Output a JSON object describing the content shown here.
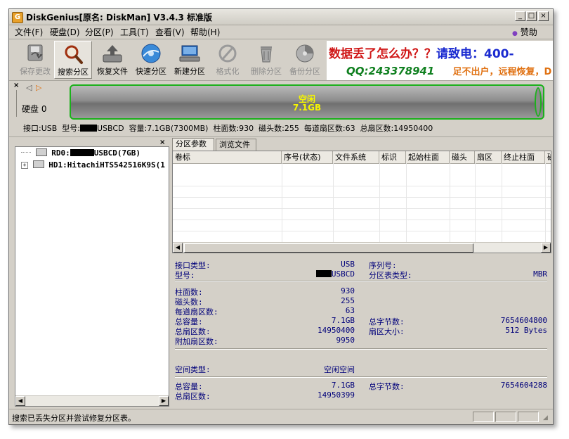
{
  "window": {
    "title": "DiskGenius[原名: DiskMan] V3.4.3 标准版",
    "controls": [
      "_",
      "□",
      "×"
    ]
  },
  "menu": {
    "items": [
      "文件(F)",
      "硬盘(D)",
      "分区(P)",
      "工具(T)",
      "查看(V)",
      "帮助(H)"
    ],
    "donate": "赞助"
  },
  "toolbar": {
    "buttons": [
      {
        "label": "保存更改",
        "icon": "save-changes-icon",
        "enabled": false
      },
      {
        "label": "搜索分区",
        "icon": "search-partition-icon",
        "enabled": true,
        "active": true
      },
      {
        "label": "恢复文件",
        "icon": "recover-files-icon",
        "enabled": true
      },
      {
        "label": "快速分区",
        "icon": "quick-partition-icon",
        "enabled": true
      },
      {
        "label": "新建分区",
        "icon": "new-partition-icon",
        "enabled": true
      },
      {
        "label": "格式化",
        "icon": "format-icon",
        "enabled": false
      },
      {
        "label": "删除分区",
        "icon": "delete-partition-icon",
        "enabled": false
      },
      {
        "label": "备份分区",
        "icon": "backup-partition-icon",
        "enabled": false
      }
    ]
  },
  "ad": {
    "line1_a": "数据丢了怎么办？？",
    "line1_b": "请致电：400-",
    "line2_a": "QQ:243378941",
    "line2_b": "足不出户，远程恢复，D"
  },
  "disk_panel": {
    "label": "硬盘 0",
    "bar_label": "空闲",
    "bar_size": "7.1GB",
    "info": {
      "interface": "接口:USB",
      "model_prefix": "型号:",
      "model_suffix": "USBCD",
      "capacity": "容量:7.1GB(7300MB)",
      "cylinders": "柱面数:930",
      "heads": "磁头数:255",
      "sectors_per_track": "每道扇区数:63",
      "total_sectors": "总扇区数:14950400"
    }
  },
  "tree": {
    "nodes": [
      {
        "prefix": "RD0:",
        "suffix": "USBCD(7GB)"
      },
      {
        "prefix": "HD1:",
        "suffix": "HitachiHTS542516K9S(1"
      }
    ]
  },
  "tabs": [
    "分区参数",
    "浏览文件"
  ],
  "grid": {
    "columns": [
      "卷标",
      "序号(状态)",
      "文件系统",
      "标识",
      "起始柱面",
      "磁头",
      "扇区",
      "终止柱面",
      "磁"
    ]
  },
  "props": {
    "interface_type_label": "接口类型:",
    "interface_type_value": "USB",
    "serial_label": "序列号:",
    "model_label": "型号:",
    "model_value": "USBCD",
    "ptable_label": "分区表类型:",
    "ptable_value": "MBR",
    "cylinders_label": "柱面数:",
    "cylinders_value": "930",
    "heads_label": "磁头数:",
    "heads_value": "255",
    "spt_label": "每道扇区数:",
    "spt_value": "63",
    "capacity_label": "总容量:",
    "capacity_value": "7.1GB",
    "total_bytes_label": "总字节数:",
    "total_bytes_value": "7654604800",
    "total_sectors_label": "总扇区数:",
    "total_sectors_value": "14950400",
    "sector_size_label": "扇区大小:",
    "sector_size_value": "512 Bytes",
    "extra_sectors_label": "附加扇区数:",
    "extra_sectors_value": "9950",
    "space_type_label": "空间类型:",
    "space_type_value": "空闲空间",
    "free_capacity_label": "总容量:",
    "free_capacity_value": "7.1GB",
    "free_bytes_label": "总字节数:",
    "free_bytes_value": "7654604288",
    "free_sectors_label": "总扇区数:",
    "free_sectors_value": "14950399"
  },
  "status": {
    "text": "搜索已丢失分区并尝试修复分区表。"
  }
}
